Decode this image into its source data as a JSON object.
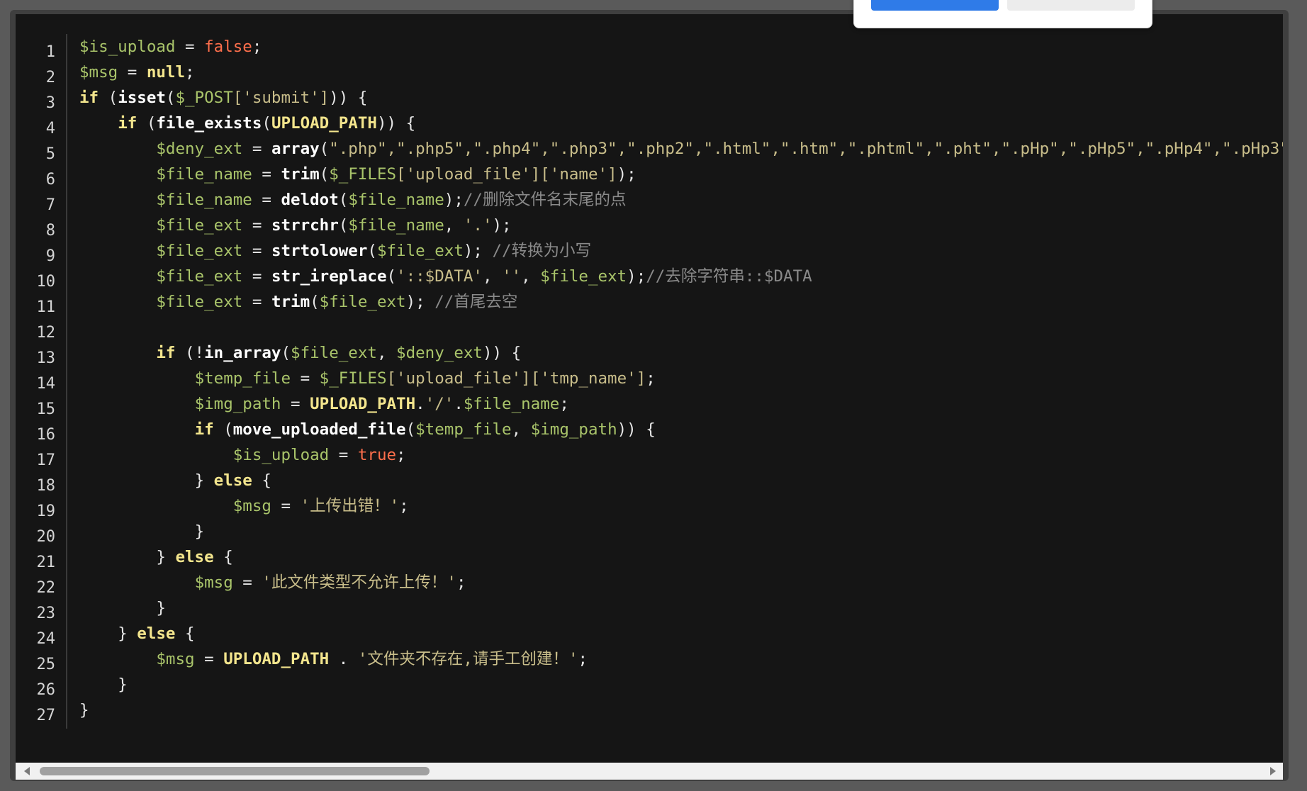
{
  "line_numbers": [
    "1",
    "2",
    "3",
    "4",
    "5",
    "6",
    "7",
    "8",
    "9",
    "10",
    "11",
    "12",
    "13",
    "14",
    "15",
    "16",
    "17",
    "18",
    "19",
    "20",
    "21",
    "22",
    "23",
    "24",
    "25",
    "26",
    "27"
  ],
  "code": {
    "l1": {
      "v": "$is_upload",
      "eq": " = ",
      "b": "false",
      "end": ";"
    },
    "l2": {
      "v": "$msg",
      "eq": " = ",
      "n": "null",
      "end": ";"
    },
    "l3": {
      "k": "if",
      "a": " (",
      "f": "isset",
      "p": "(",
      "v": "$_POST",
      "s": "['submit']",
      "end": ")) {"
    },
    "l4": {
      "ind": "    ",
      "k": "if",
      "a": " (",
      "f": "file_exists",
      "p": "(",
      "c": "UPLOAD_PATH",
      "end": ")) {"
    },
    "l5": {
      "ind": "        ",
      "v": "$deny_ext",
      "eq": " = ",
      "f": "array",
      "p": "(",
      "s": "\".php\",\".php5\",\".php4\",\".php3\",\".php2\",\".html\",\".htm\",\".phtml\",\".pht\",\".pHp\",\".pHp5\",\".pHp4\",\".pHp3\",\"."
    },
    "l6": {
      "ind": "        ",
      "v1": "$file_name",
      "eq": " = ",
      "f": "trim",
      "p": "(",
      "v2": "$_FILES",
      "s": "['upload_file']['name']",
      "end": ");"
    },
    "l7": {
      "ind": "        ",
      "v1": "$file_name",
      "eq": " = ",
      "f": "deldot",
      "p": "(",
      "v2": "$file_name",
      "end": ");",
      "cm": "//删除文件名末尾的点"
    },
    "l8": {
      "ind": "        ",
      "v1": "$file_ext",
      "eq": " = ",
      "f": "strrchr",
      "p": "(",
      "v2": "$file_name",
      "mid": ", ",
      "s": "'.'",
      "end": ");"
    },
    "l9": {
      "ind": "        ",
      "v1": "$file_ext",
      "eq": " = ",
      "f": "strtolower",
      "p": "(",
      "v2": "$file_ext",
      "end": "); ",
      "cm": "//转换为小写"
    },
    "l10": {
      "ind": "        ",
      "v1": "$file_ext",
      "eq": " = ",
      "f": "str_ireplace",
      "p": "(",
      "s1": "'::$DATA'",
      "mid1": ", ",
      "s2": "''",
      "mid2": ", ",
      "v2": "$file_ext",
      "end": ");",
      "cm": "//去除字符串::$DATA"
    },
    "l11": {
      "ind": "        ",
      "v1": "$file_ext",
      "eq": " = ",
      "f": "trim",
      "p": "(",
      "v2": "$file_ext",
      "end": "); ",
      "cm": "//首尾去空"
    },
    "l13": {
      "ind": "        ",
      "k": "if",
      "a": " (!",
      "f": "in_array",
      "p": "(",
      "v1": "$file_ext",
      "mid": ", ",
      "v2": "$deny_ext",
      "end": ")) {"
    },
    "l14": {
      "ind": "            ",
      "v1": "$temp_file",
      "eq": " = ",
      "v2": "$_FILES",
      "s": "['upload_file']['tmp_name']",
      "end": ";"
    },
    "l15": {
      "ind": "            ",
      "v": "$img_path",
      "eq": " = ",
      "c": "UPLOAD_PATH",
      "d1": ".",
      "s": "'/'",
      "d2": ".",
      "v2": "$file_name",
      "end": ";"
    },
    "l16": {
      "ind": "            ",
      "k": "if",
      "a": " (",
      "f": "move_uploaded_file",
      "p": "(",
      "v1": "$temp_file",
      "mid": ", ",
      "v2": "$img_path",
      "end": ")) {"
    },
    "l17": {
      "ind": "                ",
      "v": "$is_upload",
      "eq": " = ",
      "b": "true",
      "end": ";"
    },
    "l18": {
      "ind": "            ",
      "a": "} ",
      "k": "else",
      "end": " {"
    },
    "l19": {
      "ind": "                ",
      "v": "$msg",
      "eq": " = ",
      "s": "'上传出错！'",
      "end": ";"
    },
    "l20": {
      "ind": "            ",
      "end": "}"
    },
    "l21": {
      "ind": "        ",
      "a": "} ",
      "k": "else",
      "end": " {"
    },
    "l22": {
      "ind": "            ",
      "v": "$msg",
      "eq": " = ",
      "s": "'此文件类型不允许上传！'",
      "end": ";"
    },
    "l23": {
      "ind": "        ",
      "end": "}"
    },
    "l24": {
      "ind": "    ",
      "a": "} ",
      "k": "else",
      "end": " {"
    },
    "l25": {
      "ind": "        ",
      "v": "$msg",
      "eq": " = ",
      "c": "UPLOAD_PATH",
      "d": " . ",
      "s": "'文件夹不存在,请手工创建！'",
      "end": ";"
    },
    "l26": {
      "ind": "    ",
      "end": "}"
    },
    "l27": {
      "end": "}"
    }
  },
  "colors": {
    "variable": "#a9c46a",
    "keyword": "#f3e58d",
    "boolean": "#ff6f4c",
    "comment": "#8a8a8a",
    "string": "#c8bd8a"
  }
}
